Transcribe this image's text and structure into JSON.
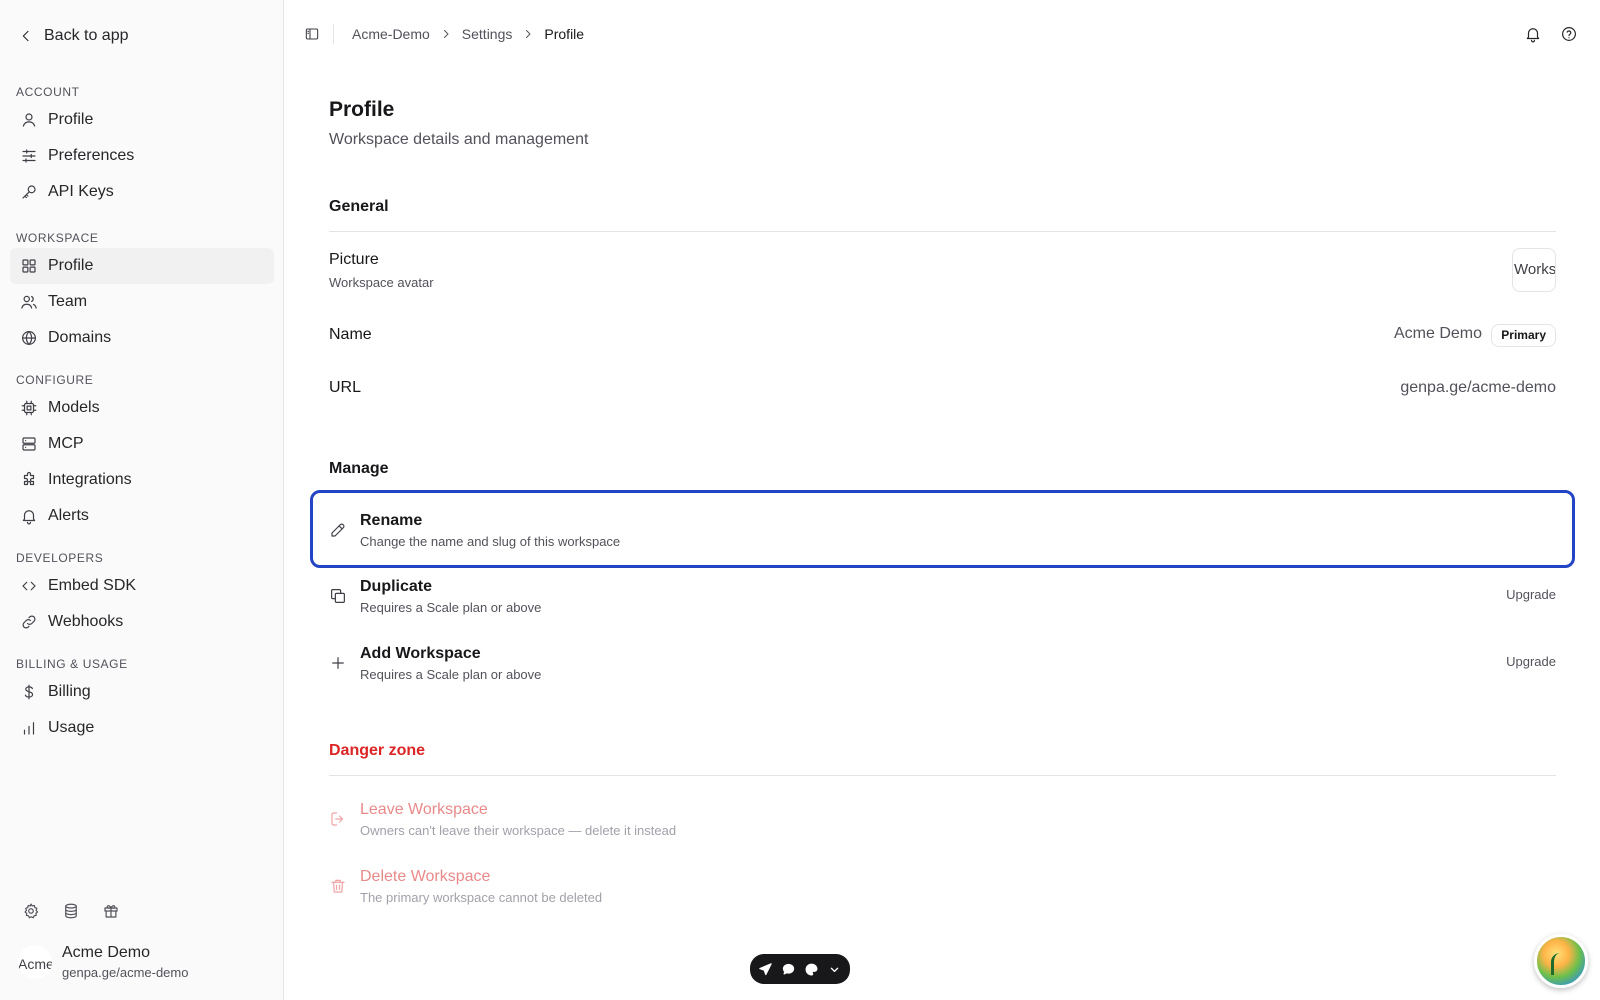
{
  "sidebar": {
    "back_label": "Back to app",
    "sections": [
      {
        "label": "ACCOUNT",
        "items": [
          {
            "label": "Profile",
            "icon": "user-icon"
          },
          {
            "label": "Preferences",
            "icon": "sliders-icon"
          },
          {
            "label": "API Keys",
            "icon": "key-icon"
          }
        ]
      },
      {
        "label": "WORKSPACE",
        "items": [
          {
            "label": "Profile",
            "icon": "grid-icon",
            "active": true
          },
          {
            "label": "Team",
            "icon": "users-icon"
          },
          {
            "label": "Domains",
            "icon": "globe-icon"
          }
        ]
      },
      {
        "label": "CONFIGURE",
        "items": [
          {
            "label": "Models",
            "icon": "chip-icon"
          },
          {
            "label": "MCP",
            "icon": "server-icon"
          },
          {
            "label": "Integrations",
            "icon": "puzzle-icon"
          },
          {
            "label": "Alerts",
            "icon": "bell-icon"
          }
        ]
      },
      {
        "label": "DEVELOPERS",
        "items": [
          {
            "label": "Embed SDK",
            "icon": "code-icon"
          },
          {
            "label": "Webhooks",
            "icon": "link-icon"
          }
        ]
      },
      {
        "label": "BILLING & USAGE",
        "items": [
          {
            "label": "Billing",
            "icon": "dollar-icon"
          },
          {
            "label": "Usage",
            "icon": "bar-chart-icon"
          }
        ]
      }
    ],
    "bottom_icons": [
      "settings-icon",
      "database-icon",
      "gift-icon"
    ],
    "user": {
      "avatar_alt": "Acme",
      "name": "Acme Demo",
      "url": "genpa.ge/acme-demo"
    }
  },
  "topbar": {
    "breadcrumb": [
      "Acme-Demo",
      "Settings",
      "Profile"
    ],
    "right_icons": [
      "bell-icon",
      "help-icon"
    ]
  },
  "page": {
    "title": "Profile",
    "subtitle": "Workspace details and management",
    "general": {
      "heading": "General",
      "picture_label": "Picture",
      "picture_sub": "Workspace avatar",
      "picture_alt": "Workspace",
      "name_label": "Name",
      "name_value": "Acme Demo",
      "name_badge": "Primary",
      "url_label": "URL",
      "url_value": "genpa.ge/acme-demo"
    },
    "manage": {
      "heading": "Manage",
      "actions": [
        {
          "title": "Rename",
          "sub": "Change the name and slug of this workspace",
          "right": "",
          "icon": "pencil-icon"
        },
        {
          "title": "Duplicate",
          "sub": "Requires a Scale plan or above",
          "right": "Upgrade",
          "icon": "copy-icon"
        },
        {
          "title": "Add Workspace",
          "sub": "Requires a Scale plan or above",
          "right": "Upgrade",
          "icon": "plus-icon"
        }
      ]
    },
    "danger": {
      "heading": "Danger zone",
      "actions": [
        {
          "title": "Leave Workspace",
          "sub": "Owners can't leave their workspace — delete it instead",
          "icon": "logout-icon"
        },
        {
          "title": "Delete Workspace",
          "sub": "The primary workspace cannot be deleted",
          "icon": "trash-icon"
        }
      ]
    }
  },
  "colors": {
    "focus_ring": "#2444c6",
    "danger": "#dc2626",
    "danger_soft": "#e88a8a",
    "sidebar_bg": "#fafafa"
  },
  "floating_toolbar": {
    "icons": [
      "send-icon",
      "chat-icon",
      "palette-icon",
      "chevron-down-icon"
    ]
  }
}
